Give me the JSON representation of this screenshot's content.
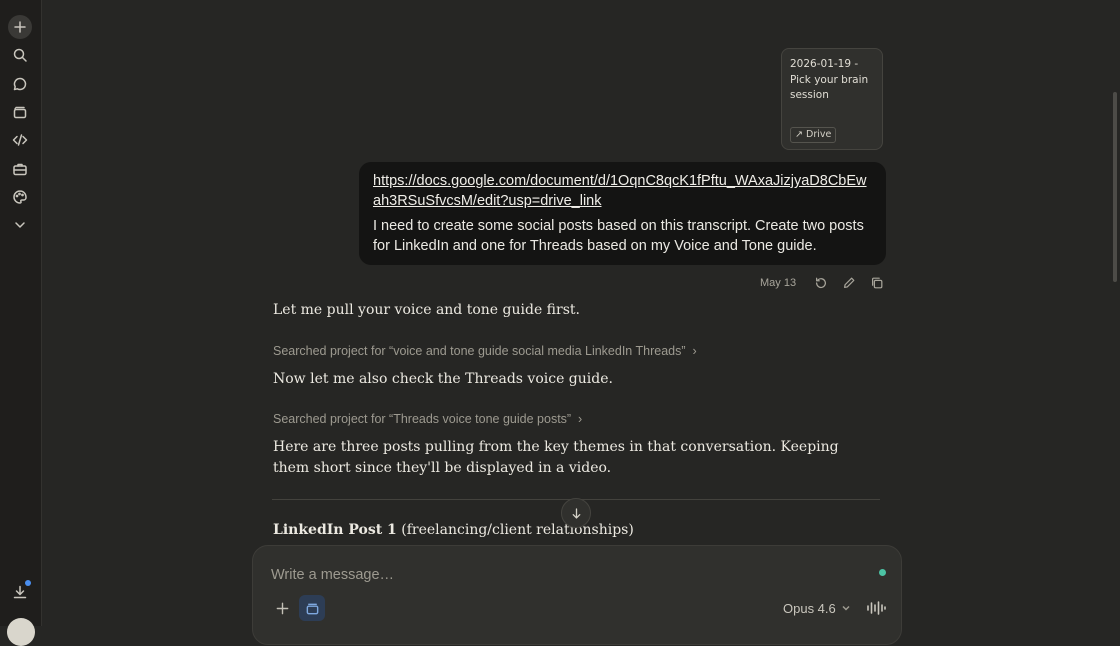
{
  "attachment": {
    "title": "2026-01-19 - Pick your brain session",
    "source_label": "Drive"
  },
  "user_message": {
    "link": "https://docs.google.com/document/d/1OqnC8qcK1fPftu_WAxaJizjyaD8CbEwah3RSuSfvcsM/edit?usp=drive_link",
    "text": "I need to create some social posts based on this transcript. Create two posts for LinkedIn and one for Threads based on my Voice and Tone guide.",
    "date": "May 13"
  },
  "assistant": {
    "line1": "Let me pull your voice and tone guide first.",
    "search1": "Searched project for “voice and tone guide social media LinkedIn Threads”",
    "line2": "Now let me also check the Threads voice guide.",
    "search2": "Searched project for “Threads voice tone guide posts”",
    "line3": "Here are three posts pulling from the key themes in that conversation. Keeping them short since they'll be displayed in a video.",
    "heading_bold": "LinkedIn Post 1",
    "heading_rest": " (freelancing/client relationships)"
  },
  "composer": {
    "placeholder": "Write a message…",
    "model": "Opus 4.6"
  },
  "colors": {
    "background": "#262624",
    "sidebar": "#1f1e1c",
    "user_bubble": "#141413",
    "status_dot": "#4cc3a4",
    "notification_dot": "#4a8ff0"
  }
}
